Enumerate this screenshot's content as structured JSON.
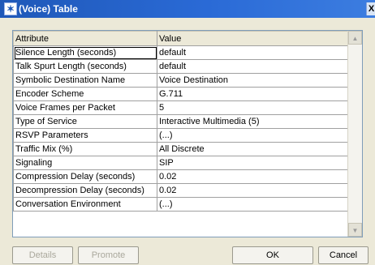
{
  "window": {
    "title": "(Voice) Table",
    "close_label": "X"
  },
  "table": {
    "headers": [
      "Attribute",
      "Value"
    ],
    "rows": [
      {
        "attribute": "Silence Length (seconds)",
        "value": "default"
      },
      {
        "attribute": "Talk Spurt Length (seconds)",
        "value": "default"
      },
      {
        "attribute": "Symbolic Destination Name",
        "value": "Voice Destination"
      },
      {
        "attribute": "Encoder Scheme",
        "value": "G.711"
      },
      {
        "attribute": "Voice Frames per Packet",
        "value": "5"
      },
      {
        "attribute": "Type of Service",
        "value": "Interactive Multimedia (5)"
      },
      {
        "attribute": "RSVP Parameters",
        "value": "(...)"
      },
      {
        "attribute": "Traffic Mix (%)",
        "value": "All Discrete"
      },
      {
        "attribute": "Signaling",
        "value": "SIP"
      },
      {
        "attribute": "Compression Delay (seconds)",
        "value": "0.02"
      },
      {
        "attribute": "Decompression Delay (seconds)",
        "value": "0.02"
      },
      {
        "attribute": "Conversation Environment",
        "value": "(...)"
      }
    ]
  },
  "buttons": {
    "details": "Details",
    "promote": "Promote",
    "ok": "OK",
    "cancel": "Cancel"
  },
  "colors": {
    "titlebar": "#2a6ad6",
    "dialog_bg": "#ece9d8",
    "grid_border": "#7f9db9"
  }
}
